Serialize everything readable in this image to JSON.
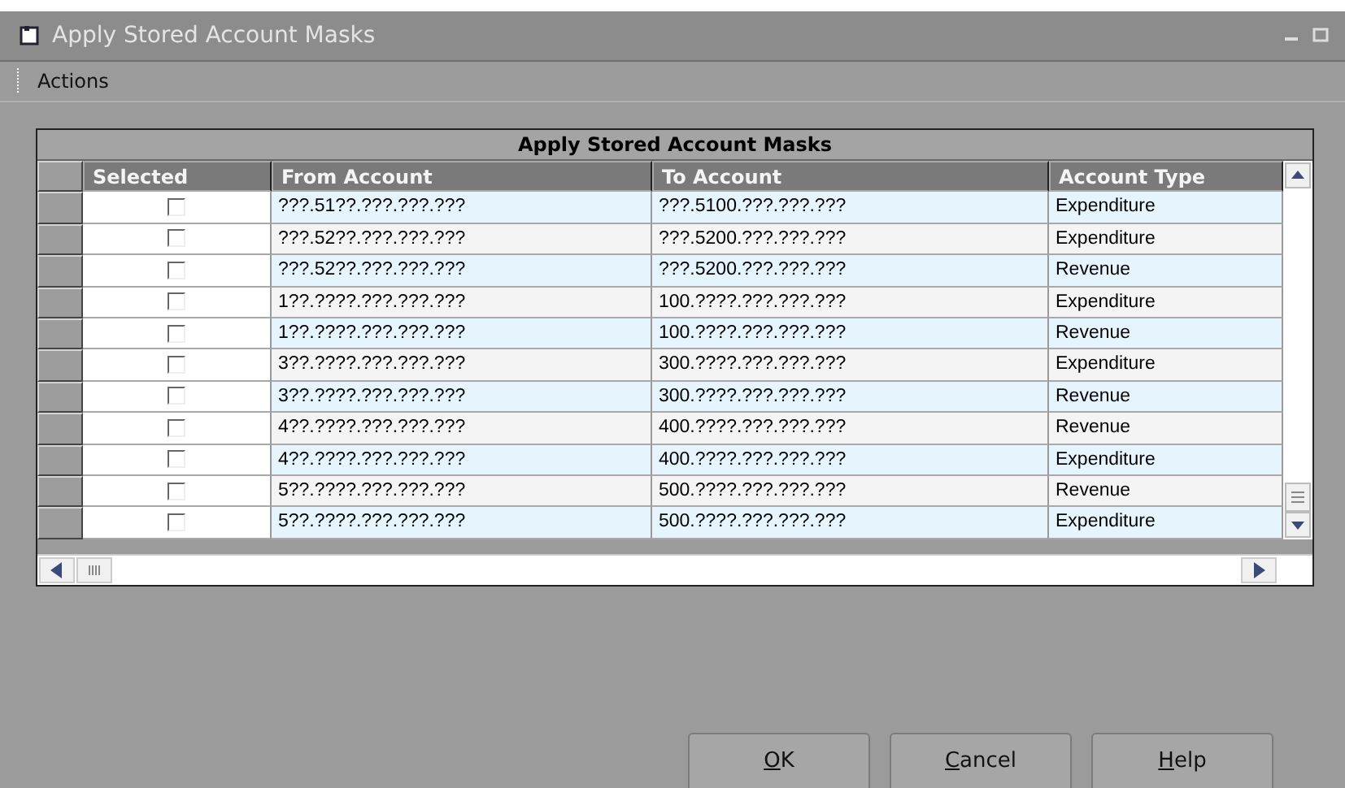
{
  "window": {
    "title": "Apply Stored Account Masks"
  },
  "menu": [
    "Actions"
  ],
  "grid": {
    "caption": "Apply Stored Account Masks",
    "columns": [
      "Selected",
      "From Account",
      "To Account",
      "Account Type"
    ],
    "rows": [
      {
        "checked": false,
        "from": "???.51??.???.???.???",
        "to": "???.5100.???.???.???",
        "type": "Expenditure"
      },
      {
        "checked": false,
        "from": "???.52??.???.???.???",
        "to": "???.5200.???.???.???",
        "type": "Expenditure"
      },
      {
        "checked": false,
        "from": "???.52??.???.???.???",
        "to": "???.5200.???.???.???",
        "type": "Revenue"
      },
      {
        "checked": false,
        "from": "1??.????.???.???.???",
        "to": "100.????.???.???.???",
        "type": "Expenditure"
      },
      {
        "checked": false,
        "from": "1??.????.???.???.???",
        "to": "100.????.???.???.???",
        "type": "Revenue"
      },
      {
        "checked": false,
        "from": "3??.????.???.???.???",
        "to": "300.????.???.???.???",
        "type": "Expenditure"
      },
      {
        "checked": false,
        "from": "3??.????.???.???.???",
        "to": "300.????.???.???.???",
        "type": "Revenue"
      },
      {
        "checked": false,
        "from": "4??.????.???.???.???",
        "to": "400.????.???.???.???",
        "type": "Revenue"
      },
      {
        "checked": false,
        "from": "4??.????.???.???.???",
        "to": "400.????.???.???.???",
        "type": "Expenditure"
      },
      {
        "checked": false,
        "from": "5??.????.???.???.???",
        "to": "500.????.???.???.???",
        "type": "Revenue"
      },
      {
        "checked": false,
        "from": "5??.????.???.???.???",
        "to": "500.????.???.???.???",
        "type": "Expenditure"
      }
    ]
  },
  "buttons": [
    "OK",
    "Cancel",
    "Help"
  ]
}
